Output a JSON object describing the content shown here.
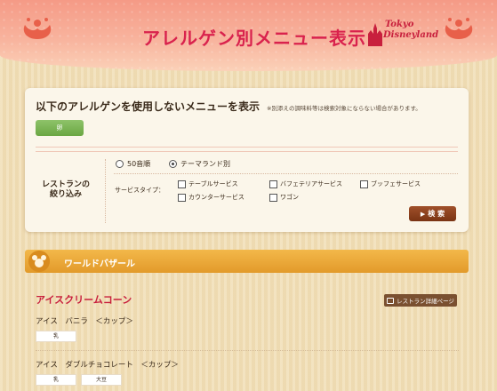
{
  "header": {
    "title": "アレルゲン別メニュー表示",
    "logo_line1": "Tokyo",
    "logo_line2": "Disneyland"
  },
  "panel": {
    "title": "以下のアレルゲンを使用しないメニューを表示",
    "note": "※別添えの調味料等は検索対象にならない場合があります。",
    "allergen_button": "卵"
  },
  "filter": {
    "label_line1": "レストランの",
    "label_line2": "絞り込み",
    "sort_options": [
      {
        "label": "50音順",
        "selected": false
      },
      {
        "label": "テーマランド別",
        "selected": true
      }
    ],
    "service_label": "サービスタイプ：",
    "services": [
      {
        "label": "テーブルサービス",
        "checked": false
      },
      {
        "label": "バフェテリアサービス",
        "checked": false
      },
      {
        "label": "ブッフェサービス",
        "checked": false
      },
      {
        "label": "カウンターサービス",
        "checked": false
      },
      {
        "label": "ワゴン",
        "checked": false
      }
    ],
    "search_button": "検 索"
  },
  "area": {
    "name": "ワールドバザール"
  },
  "restaurant": {
    "name": "アイスクリームコーン",
    "detail_button": "レストラン詳細ページ",
    "menus": [
      {
        "name": "アイス　バニラ　＜カップ＞",
        "tags": [
          "乳"
        ]
      },
      {
        "name": "アイス　ダブルチョコレート　＜カップ＞",
        "tags": [
          "乳",
          "大豆"
        ]
      }
    ]
  },
  "colors": {
    "title_red": "#d9224d",
    "allergen_green": "#6aa642",
    "search_brown": "#7a3414",
    "area_orange": "#e29a2a",
    "restaurant_red": "#c81f3c"
  }
}
